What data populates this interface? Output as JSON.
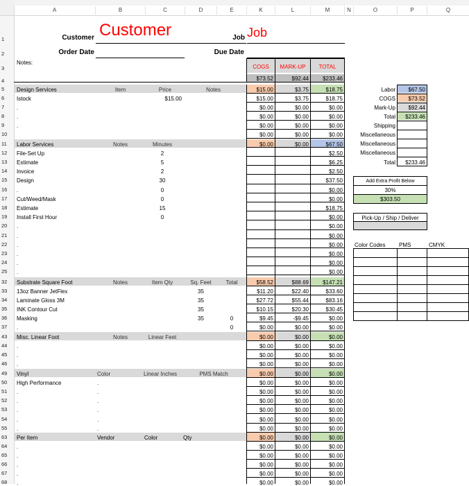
{
  "columns": [
    "A",
    "B",
    "C",
    "D",
    "E",
    "K",
    "L",
    "M",
    "N",
    "O",
    "P",
    "Q"
  ],
  "row_numbers": [
    "1",
    "2",
    "3",
    "4",
    "5",
    "6",
    "7",
    "8",
    "9",
    "10",
    "11",
    "12",
    "13",
    "14",
    "15",
    "16",
    "17",
    "18",
    "19",
    "20",
    "21",
    "22",
    "23",
    "24",
    "25",
    "32",
    "33",
    "34",
    "35",
    "36",
    "37",
    "43",
    "44",
    "45",
    "46",
    "49",
    "50",
    "51",
    "52",
    "53",
    "54",
    "55",
    "63",
    "64",
    "65",
    "66",
    "67",
    "68"
  ],
  "header": {
    "customer_label": "Customer",
    "customer_value": "Customer",
    "job_label": "Job",
    "job_value": "Job",
    "order_date_label": "Order Date",
    "due_date_label": "Due Date",
    "notes_label": "Notes:",
    "cogs_header": "COGS",
    "markup_header": "MARK-UP",
    "total_header": "TOTAL",
    "cogs_total": "$73.52",
    "markup_total": "$92.44",
    "total_total": "$233.46"
  },
  "sections": {
    "design": {
      "title": "Design Services",
      "c1": "Item",
      "c2": "Price",
      "c3": "Notes",
      "cogs": "$15.00",
      "markup": "$3.75",
      "total": "$18.75"
    },
    "labor": {
      "title": "Labor Services",
      "c1": "Notes",
      "c2": "Minutes",
      "cogs": "$0.00",
      "markup": "$0.00",
      "total": "$67.50"
    },
    "substrate": {
      "title": "Substrate Square Foot",
      "c1": "Notes",
      "c2": "Item Qty",
      "c3": "Sq. Feet",
      "c4": "Total",
      "cogs": "$58.52",
      "markup": "$88.69",
      "total": "$147.21"
    },
    "misc": {
      "title": "Misc. Linear Foot",
      "c1": "Notes",
      "c2": "Linear Feet",
      "cogs": "$0.00",
      "markup": "$0.00",
      "total": "$0.00"
    },
    "vinyl": {
      "title": "Vinyl",
      "c1": "Color",
      "c2": "Linear Inches",
      "c3": "PMS Match",
      "cogs": "$0.00",
      "markup": "$0.00",
      "total": "$0.00"
    },
    "peritem": {
      "title": "Per Item",
      "c1": "Vendor",
      "c2": "Color",
      "c3": "Qty",
      "cogs": "$0.00",
      "markup": "$0.00",
      "total": "$0.00"
    }
  },
  "rows": {
    "design": [
      {
        "name": "Istock",
        "price": "$15.00",
        "cogs": "$15.00",
        "markup": "$3.75",
        "total": "$18.75"
      },
      {
        "name": ".",
        "cogs": "$0.00",
        "markup": "$0.00",
        "total": "$0.00"
      },
      {
        "name": ".",
        "cogs": "$0.00",
        "markup": "$0.00",
        "total": "$0.00"
      },
      {
        "name": ".",
        "cogs": "$0.00",
        "markup": "$0.00",
        "total": "$0.00"
      }
    ],
    "labor": [
      {
        "name": "File-Set Up",
        "min": "2",
        "total": "$2.50"
      },
      {
        "name": "Estimate",
        "min": "5",
        "total": "$6.25"
      },
      {
        "name": "Invoice",
        "min": "2",
        "total": "$2.50"
      },
      {
        "name": "Design",
        "min": "30",
        "total": "$37.50"
      },
      {
        "name": ".",
        "min": "0",
        "total": "$0.00"
      },
      {
        "name": "Cut/Weed/Mask",
        "min": "0",
        "total": "$0.00"
      },
      {
        "name": "Estimate",
        "min": "15",
        "total": "$18.75"
      },
      {
        "name": "Install First Hour",
        "min": "0",
        "total": "$0.00"
      },
      {
        "name": ".",
        "min": "",
        "total": "$0.00"
      },
      {
        "name": ".",
        "min": "",
        "total": "$0.00"
      },
      {
        "name": ".",
        "min": "",
        "total": "$0.00"
      },
      {
        "name": ".",
        "min": "",
        "total": "$0.00"
      },
      {
        "name": ".",
        "min": "",
        "total": "$0.00"
      },
      {
        "name": ".",
        "min": "",
        "total": "$0.00"
      }
    ],
    "substrate": [
      {
        "name": "13oz Banner JetFlex",
        "sq": "35",
        "tot": "",
        "cogs": "$11.20",
        "markup": "$22.40",
        "total": "$33.60"
      },
      {
        "name": "Laminate Gloss 3M",
        "sq": "35",
        "tot": "",
        "cogs": "$27.72",
        "markup": "$55.44",
        "total": "$83.16"
      },
      {
        "name": "INK Contour Cut",
        "sq": "35",
        "tot": "",
        "cogs": "$10.15",
        "markup": "$20.30",
        "total": "$30.45"
      },
      {
        "name": "Masking",
        "sq": "35",
        "tot": "0",
        "cogs": "$9.45",
        "markup": "-$9.45",
        "total": "$0.00"
      },
      {
        "name": ".",
        "sq": "",
        "tot": "0",
        "cogs": "$0.00",
        "markup": "$0.00",
        "total": "$0.00"
      }
    ],
    "misc": [
      {
        "name": ".",
        "cogs": "$0.00",
        "markup": "$0.00",
        "total": "$0.00"
      },
      {
        "name": ".",
        "cogs": "$0.00",
        "markup": "$0.00",
        "total": "$0.00"
      },
      {
        "name": ".",
        "cogs": "$0.00",
        "markup": "$0.00",
        "total": "$0.00"
      }
    ],
    "vinyl": [
      {
        "name": "High Performance",
        "b": ".",
        "cogs": "$0.00",
        "markup": "$0.00",
        "total": "$0.00"
      },
      {
        "name": ".",
        "b": ".",
        "cogs": "$0.00",
        "markup": "$0.00",
        "total": "$0.00"
      },
      {
        "name": ".",
        "b": ".",
        "cogs": "$0.00",
        "markup": "$0.00",
        "total": "$0.00"
      },
      {
        "name": ".",
        "b": ".",
        "cogs": "$0.00",
        "markup": "$0.00",
        "total": "$0.00"
      },
      {
        "name": ".",
        "b": ".",
        "cogs": "$0.00",
        "markup": "$0.00",
        "total": "$0.00"
      },
      {
        "name": ".",
        "b": ".",
        "cogs": "$0.00",
        "markup": "$0.00",
        "total": "$0.00"
      }
    ],
    "peritem": [
      {
        "name": ".",
        "cogs": "$0.00",
        "markup": "$0.00",
        "total": "$0.00"
      },
      {
        "name": ".",
        "cogs": "$0.00",
        "markup": "$0.00",
        "total": "$0.00"
      },
      {
        "name": ".",
        "cogs": "$0.00",
        "markup": "$0.00",
        "total": "$0.00"
      },
      {
        "name": ".",
        "cogs": "$0.00",
        "markup": "$0.00",
        "total": "$0.00"
      },
      {
        "name": ".",
        "cogs": "$0.00",
        "markup": "$0.00",
        "total": "$0.00"
      }
    ]
  },
  "summary": {
    "labor_label": "Labor",
    "labor": "$67.50",
    "cogs_label": "COGS",
    "cogs": "$73.52",
    "markup_label": "Mark-Up",
    "markup": "$92.44",
    "total_label": "Total",
    "total": "$233.46",
    "shipping_label": "Shipping",
    "misc1": "Miscellaneous",
    "misc2": "Miscellaneous",
    "misc3": "Miscellaneous",
    "total2_label": "Total",
    "total2": "$233.46",
    "extra_profit_label": "Add Extra Profit Below",
    "extra_pct": "30%",
    "extra_value": "$303.50",
    "pickup_label": "Pick-Up / Ship / Deliver",
    "color_codes": "Color Codes",
    "pms": "PMS",
    "cmyk": "CMYK"
  },
  "colors": {
    "salmon": "#f8cbad",
    "green": "#c6e0b4",
    "blue": "#b4c6e7",
    "gray": "#d9d9d9",
    "gray_dark": "#bfbfbf",
    "red": "#ff0000"
  }
}
